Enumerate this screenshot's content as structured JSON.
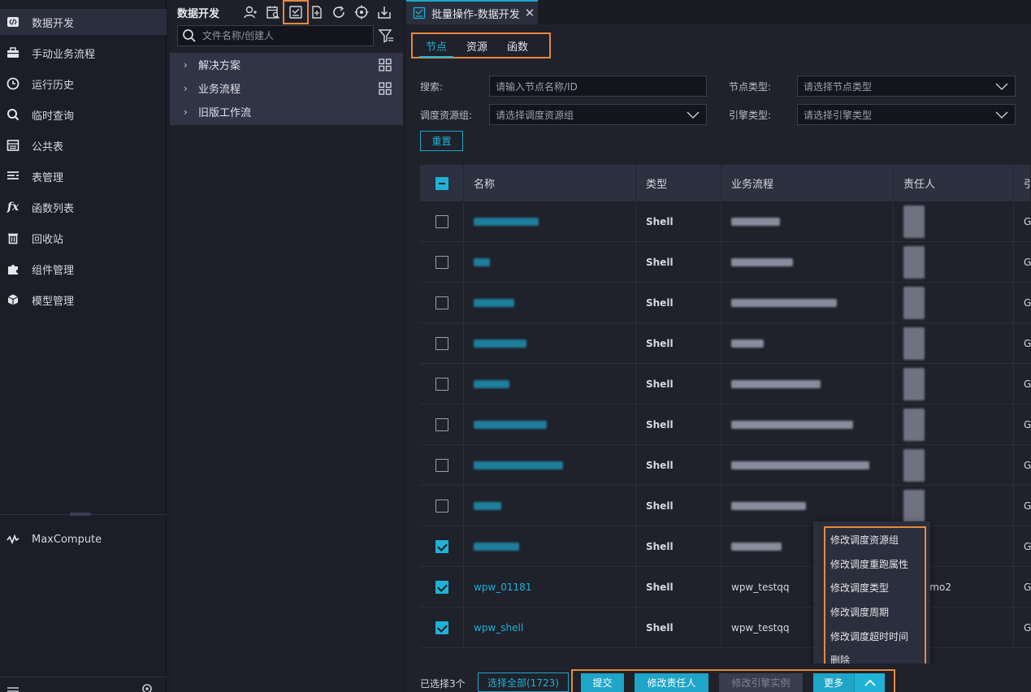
{
  "leftnav": {
    "items": [
      {
        "label": "数据开发",
        "icon": "code-icon"
      },
      {
        "label": "手动业务流程",
        "icon": "briefcase-icon"
      },
      {
        "label": "运行历史",
        "icon": "clock-icon"
      },
      {
        "label": "临时查询",
        "icon": "search-icon"
      },
      {
        "label": "公共表",
        "icon": "table-icon"
      },
      {
        "label": "表管理",
        "icon": "list-icon"
      },
      {
        "label": "函数列表",
        "icon": "fx-icon"
      },
      {
        "label": "回收站",
        "icon": "trash-icon"
      },
      {
        "label": "组件管理",
        "icon": "puzzle-icon"
      },
      {
        "label": "模型管理",
        "icon": "cube-icon"
      }
    ],
    "engine": {
      "label": "MaxCompute",
      "icon": "pulse-icon"
    }
  },
  "explorer": {
    "title": "数据开发",
    "search_placeholder": "文件名称/创建人",
    "tree": [
      {
        "label": "解决方案"
      },
      {
        "label": "业务流程"
      },
      {
        "label": "旧版工作流"
      }
    ]
  },
  "main": {
    "tab_label": "批量操作-数据开发",
    "subtabs": [
      "节点",
      "资源",
      "函数"
    ],
    "filters": {
      "search_label": "搜索:",
      "search_placeholder": "请输入节点名称/ID",
      "node_type_label": "节点类型:",
      "node_type_placeholder": "请选择节点类型",
      "resource_group_label": "调度资源组:",
      "resource_group_placeholder": "请选择调度资源组",
      "engine_type_label": "引擎类型:",
      "engine_type_placeholder": "请选择引擎类型",
      "reset_label": "重置"
    },
    "table": {
      "columns": [
        "名称",
        "类型",
        "业务流程",
        "责任人",
        "引"
      ],
      "rows": [
        {
          "name": "",
          "type": "Shell",
          "flow": "",
          "owner": "",
          "last": "G",
          "checked": false
        },
        {
          "name": "",
          "type": "Shell",
          "flow": "",
          "owner": "",
          "last": "G",
          "checked": false
        },
        {
          "name": "",
          "type": "Shell",
          "flow": "",
          "owner": "",
          "last": "G",
          "checked": false
        },
        {
          "name": "",
          "type": "Shell",
          "flow": "",
          "owner": "",
          "last": "G",
          "checked": false
        },
        {
          "name": "",
          "type": "Shell",
          "flow": "",
          "owner": "",
          "last": "G",
          "checked": false
        },
        {
          "name": "",
          "type": "Shell",
          "flow": "",
          "owner": "",
          "last": "G",
          "checked": false
        },
        {
          "name": "",
          "type": "Shell",
          "flow": "",
          "owner": "",
          "last": "G",
          "checked": false
        },
        {
          "name": "",
          "type": "Shell",
          "flow": "",
          "owner": "",
          "last": "G",
          "checked": false
        },
        {
          "name": "",
          "type": "Shell",
          "flow": "",
          "owner": "",
          "last": "G",
          "checked": true
        },
        {
          "name": "wpw_01181",
          "type": "Shell",
          "flow": "wpw_testqq",
          "owner": "works_demo2",
          "last": "G",
          "checked": true
        },
        {
          "name": "wpw_shell",
          "type": "Shell",
          "flow": "wpw_testqq",
          "owner": "",
          "last": "G",
          "checked": true
        }
      ]
    },
    "more_menu": [
      "修改调度资源组",
      "修改调度重跑属性",
      "修改调度类型",
      "修改调度周期",
      "修改调度超时时间",
      "删除"
    ]
  },
  "footer": {
    "selected": "已选择3个",
    "select_all": "选择全部(1723)",
    "submit": "提交",
    "change_owner": "修改责任人",
    "change_engine": "修改引擎实例",
    "more": "更多"
  },
  "colors": {
    "accent": "#1fb2d6",
    "highlight": "#e8893a",
    "bg": "#1f212b"
  }
}
